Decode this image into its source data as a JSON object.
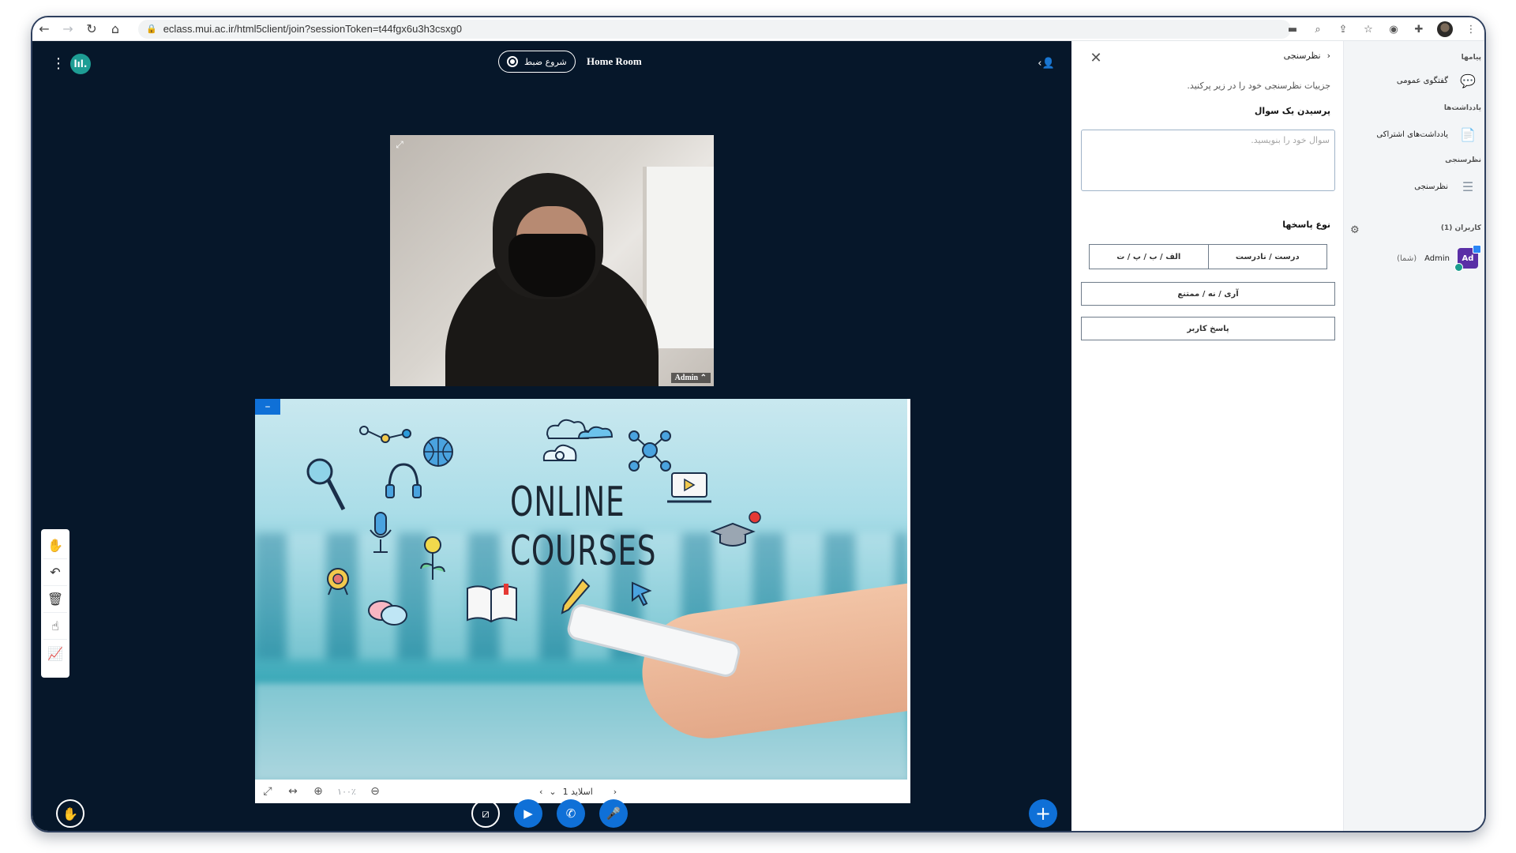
{
  "browser": {
    "url": "eclass.mui.ac.ir/html5client/join?sessionToken=t44fgx6u3h3csxg0"
  },
  "header": {
    "logo_text": "lıl.",
    "record_label": "شروع ضبط",
    "room_title": "Home Room"
  },
  "webcam": {
    "name": "Admin ⌃"
  },
  "presentation": {
    "slide_title_line1": "ONLINE",
    "slide_title_line2": "COURSES",
    "zoom": "۱۰۰٪",
    "slide_label": "اسلاید 1",
    "minimize_label": "–"
  },
  "poll": {
    "back_label": "نظرسنجی",
    "description": "جزییات نظرسنجی خود را در زیر پرکنید.",
    "question_label": "پرسیدن یک سوال",
    "question_placeholder": "سوال خود را بنویسید.",
    "response_types_label": "نوع پاسخها",
    "true_false": "درست / نادرست",
    "abcd": "الف / ب / پ / ت",
    "yes_no_abstain": "آری / نه / ممتنع",
    "user_response": "پاسخ کاربر"
  },
  "sidebar": {
    "messages_title": "پیامها",
    "public_chat": "گفتگوی عمومی",
    "notes_title": "یادداشت‌ها",
    "shared_notes": "یادداشت‌های اشتراکی",
    "polling_title": "نظرسنجی",
    "polling_item": "نظرسنجی",
    "users_title": "کاربران (1)",
    "user_name": "Admin",
    "user_you": "(شما)",
    "avatar_initials": "Ad"
  },
  "colors": {
    "meeting_bg": "#06172a",
    "accent_blue": "#0f70d7",
    "logo_teal": "#1e9d94",
    "avatar_purple": "#5a2fa6"
  }
}
